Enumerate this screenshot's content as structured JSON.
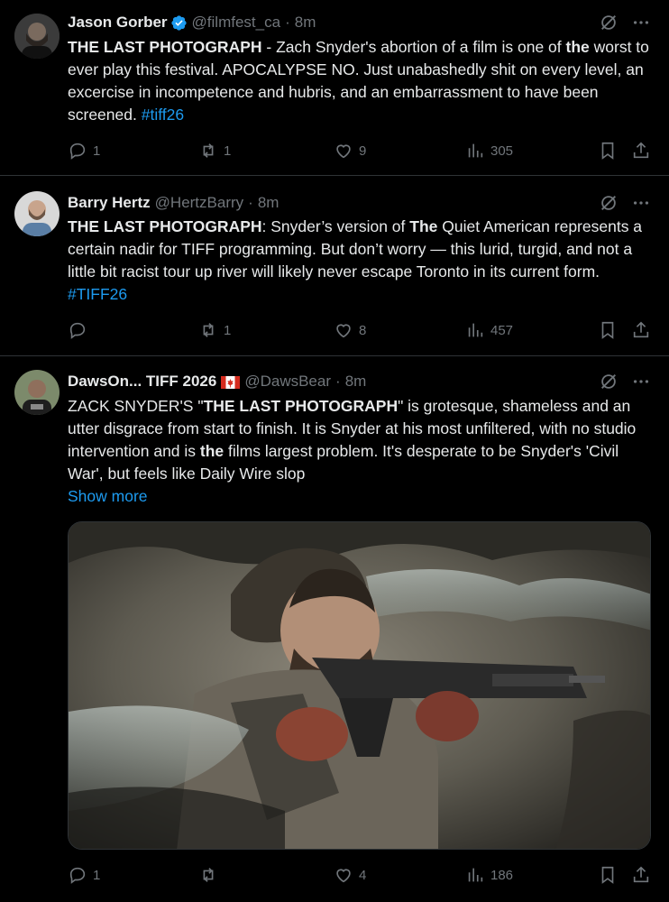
{
  "tweets": [
    {
      "name": "Jason Gorber",
      "handle": "@filmfest_ca",
      "sep": "·",
      "time": "8m",
      "text": {
        "b1": "THE LAST PHOTOGRAPH",
        "t1": " - Zach Snyder's abortion of a film is one of ",
        "b2": "the",
        "t2": " worst to ever play this festival. APOCALYPSE NO. Just unabashedly shit on every level, an excercise in incompetence and hubris, and an embarrassment to have been screened. ",
        "tag": "#tiff26"
      },
      "replies": "1",
      "reposts": "1",
      "likes": "9",
      "views": "305"
    },
    {
      "name": "Barry Hertz",
      "handle": "@HertzBarry",
      "sep": "·",
      "time": "8m",
      "text": {
        "b1": "THE LAST PHOTOGRAPH",
        "t1": ": Snyder’s version of ",
        "b2": "The",
        "t2": " Quiet American represents a certain nadir for TIFF programming. But don’t worry — this lurid, turgid, and not a little bit racist tour up river will likely never escape Toronto in its current form. ",
        "tag": "#TIFF26"
      },
      "replies": "",
      "reposts": "1",
      "likes": "8",
      "views": "457"
    },
    {
      "name": "DawsOn... TIFF 2026",
      "handle": "@DawsBear",
      "sep": "·",
      "time": "8m",
      "text": {
        "t0": "ZACK SNYDER'S \"",
        "b1": "THE LAST PHOTOGRAPH",
        "t1": "\" is grotesque, shameless and an utter disgrace from start to finish. It is Snyder at his most unfiltered, with no studio intervention and is ",
        "b2": "the",
        "t2": " films largest problem. It's desperate to be Snyder's 'Civil War', but feels like Daily Wire slop"
      },
      "show_more": "Show more",
      "replies": "1",
      "reposts": "",
      "likes": "4",
      "views": "186"
    }
  ],
  "colors": {
    "accent": "#1d9bf0",
    "muted": "#71767b",
    "text": "#e7e9ea",
    "border": "#2f3336",
    "background": "#000000"
  },
  "icons": [
    "verified-badge-icon",
    "grok-icon",
    "more-icon",
    "reply-icon",
    "repost-icon",
    "like-icon",
    "views-icon",
    "bookmark-icon",
    "share-icon",
    "canada-flag-icon"
  ]
}
